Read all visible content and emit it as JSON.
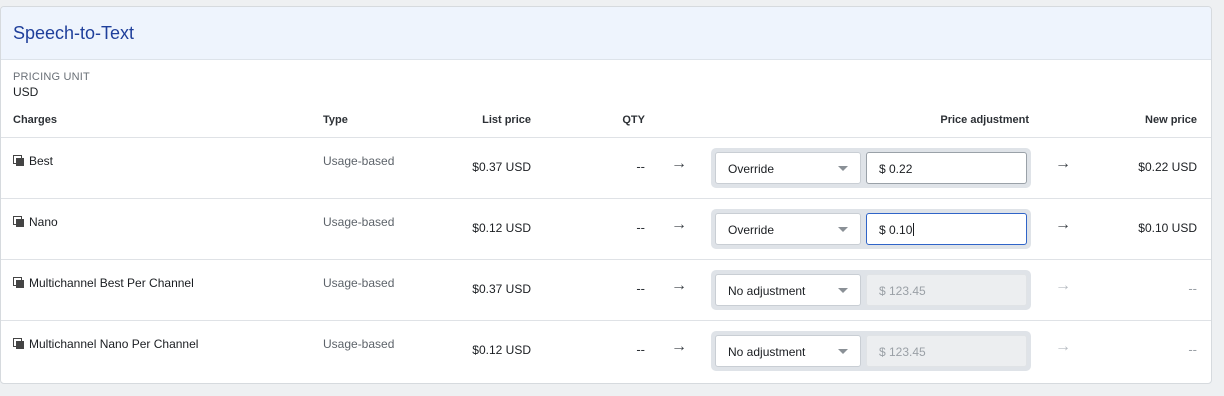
{
  "section": {
    "title": "Speech-to-Text"
  },
  "pricing_unit": {
    "label": "PRICING UNIT",
    "value": "USD"
  },
  "columns": {
    "charges": "Charges",
    "type": "Type",
    "list_price": "List price",
    "qty": "QTY",
    "price_adjustment": "Price adjustment",
    "new_price": "New price"
  },
  "rows": [
    {
      "name": "Best",
      "type": "Usage-based",
      "list_price": "$0.37 USD",
      "qty": "--",
      "adjustment": "Override",
      "price_value": "$ 0.22",
      "new_price": "$0.22 USD"
    },
    {
      "name": "Nano",
      "type": "Usage-based",
      "list_price": "$0.12 USD",
      "qty": "--",
      "adjustment": "Override",
      "price_value": "$ 0.10",
      "new_price": "$0.10 USD"
    },
    {
      "name": "Multichannel Best Per Channel",
      "type": "Usage-based",
      "list_price": "$0.37 USD",
      "qty": "--",
      "adjustment": "No adjustment",
      "price_placeholder": "$ 123.45",
      "new_price": "--"
    },
    {
      "name": "Multichannel Nano Per Channel",
      "type": "Usage-based",
      "list_price": "$0.12 USD",
      "qty": "--",
      "adjustment": "No adjustment",
      "price_placeholder": "$ 123.45",
      "new_price": "--"
    }
  ],
  "icons": {
    "charge": "copy-icon",
    "arrow": "arrow-right-icon",
    "dropdown": "chevron-down-icon"
  },
  "colors": {
    "accent": "#1f3f9b",
    "header_bg": "#eef4fd",
    "focus": "#2f64c8"
  }
}
